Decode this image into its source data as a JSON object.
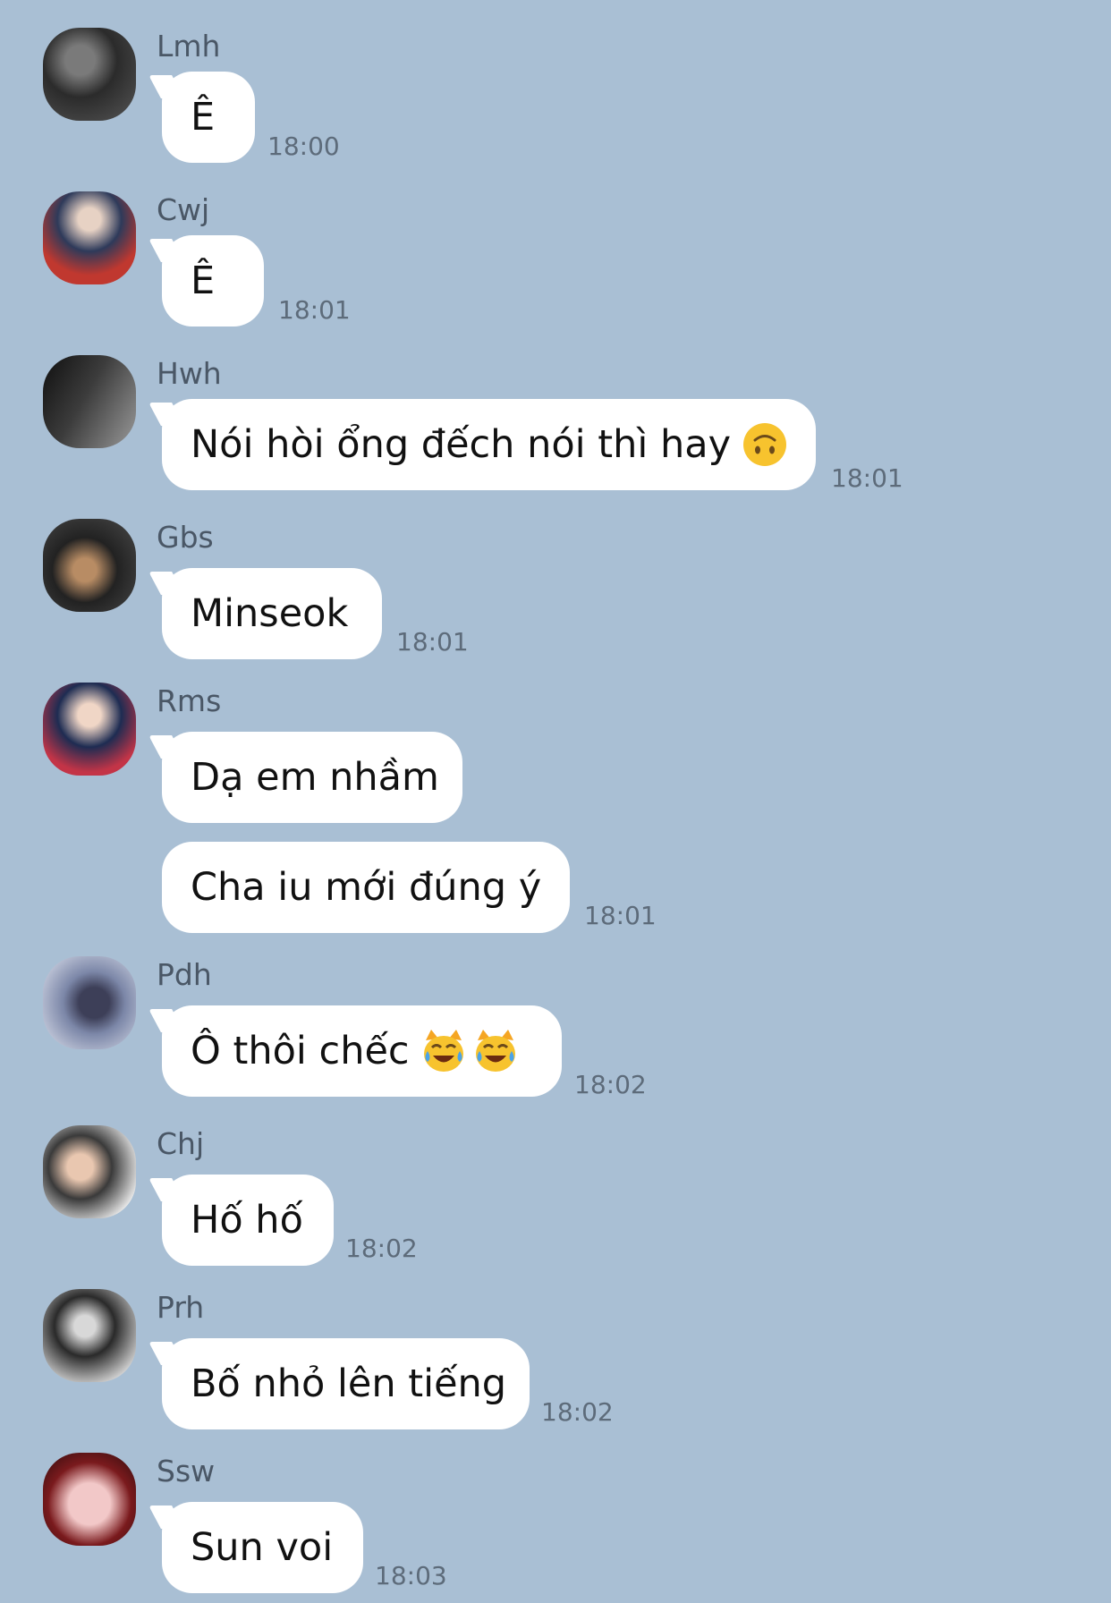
{
  "messages": [
    {
      "sender": "Lmh",
      "avatar_colors": [
        "#2b2b2b",
        "#6d6d6d"
      ],
      "bubbles": [
        {
          "text": "Ê"
        }
      ],
      "time": "18:00"
    },
    {
      "sender": "Cwj",
      "avatar_colors": [
        "#c0382f",
        "#2e3a5a"
      ],
      "bubbles": [
        {
          "text": "Ê"
        }
      ],
      "time": "18:01"
    },
    {
      "sender": "Hwh",
      "avatar_colors": [
        "#1c1c1c",
        "#8a8a8a"
      ],
      "bubbles": [
        {
          "text": "Nói hòi ổng đếch nói thì hay",
          "emoji": "upside-down-face-icon"
        }
      ],
      "time": "18:01"
    },
    {
      "sender": "Gbs",
      "avatar_colors": [
        "#222222",
        "#b88c64"
      ],
      "bubbles": [
        {
          "text": "Minseok"
        }
      ],
      "time": "18:01"
    },
    {
      "sender": "Rms",
      "avatar_colors": [
        "#c33447",
        "#1e2c52"
      ],
      "bubbles": [
        {
          "text": "Dạ em nhầm"
        },
        {
          "text": "Cha iu mới đúng ý"
        }
      ],
      "time": "18:01"
    },
    {
      "sender": "Pdh",
      "avatar_colors": [
        "#dfe3ee",
        "#3d3f58"
      ],
      "bubbles": [
        {
          "text": "Ô thôi chếc",
          "emoji_count": 2,
          "emoji": "cat-tears-of-joy-icon"
        }
      ],
      "time": "18:02"
    },
    {
      "sender": "Chj",
      "avatar_colors": [
        "#e8e8e8",
        "#3a3a3a"
      ],
      "bubbles": [
        {
          "text": "Hố hố"
        }
      ],
      "time": "18:02"
    },
    {
      "sender": "Prh",
      "avatar_colors": [
        "#e6e6e6",
        "#2a2a2a"
      ],
      "bubbles": [
        {
          "text": "Bố nhỏ lên tiếng"
        }
      ],
      "time": "18:02"
    },
    {
      "sender": "Ssw",
      "avatar_colors": [
        "#7a1a1d",
        "#f2c8c8"
      ],
      "bubbles": [
        {
          "text": "Sun voi"
        }
      ],
      "time": "18:03"
    }
  ],
  "colors": {
    "background": "#a9bfd4",
    "bubble": "#ffffff",
    "sender_text": "#4a5766",
    "time_text": "#5d6b7a"
  }
}
